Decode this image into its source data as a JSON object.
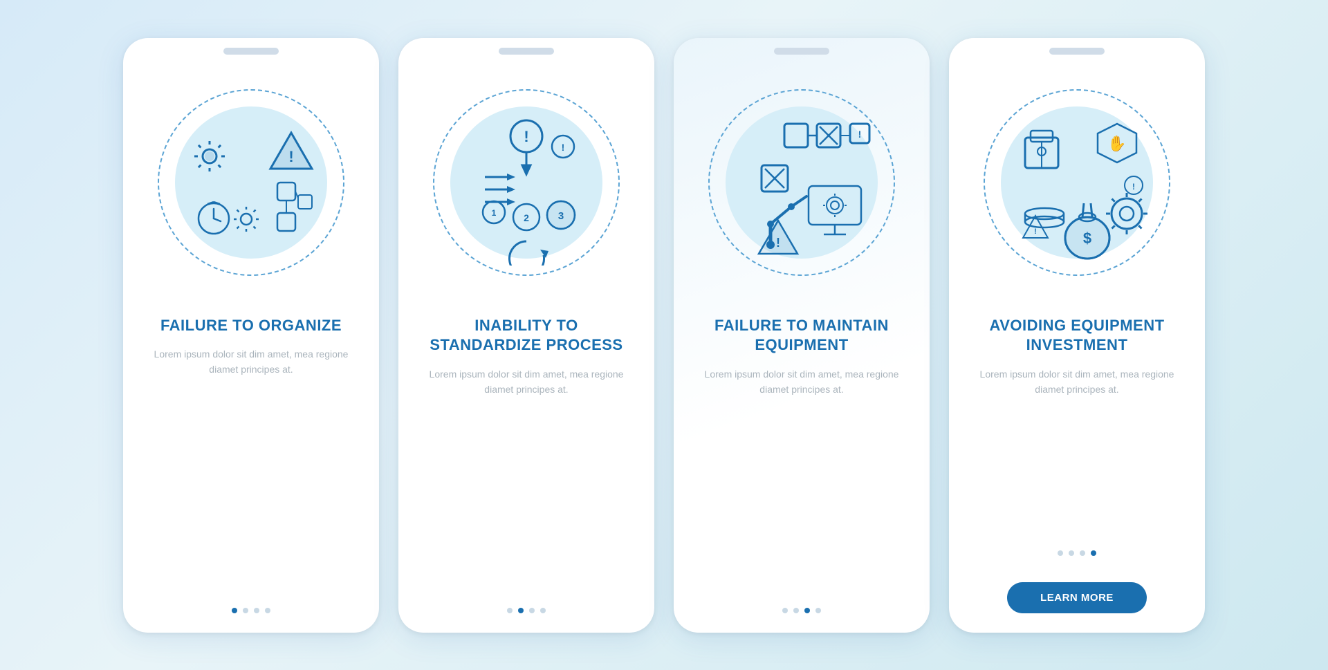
{
  "background": {
    "gradient_start": "#d6eaf8",
    "gradient_end": "#cde8f0"
  },
  "cards": [
    {
      "id": "card-1",
      "title": "FAILURE TO ORGANIZE",
      "body": "Lorem ipsum dolor sit dim amet, mea regione diamet principes at.",
      "dots": [
        true,
        false,
        false,
        false
      ],
      "has_button": false,
      "button_label": ""
    },
    {
      "id": "card-2",
      "title": "INABILITY TO STANDARDIZE PROCESS",
      "body": "Lorem ipsum dolor sit dim amet, mea regione diamet principes at.",
      "dots": [
        false,
        true,
        false,
        false
      ],
      "has_button": false,
      "button_label": ""
    },
    {
      "id": "card-3",
      "title": "FAILURE TO MAINTAIN EQUIPMENT",
      "body": "Lorem ipsum dolor sit dim amet, mea regione diamet principes at.",
      "dots": [
        false,
        false,
        true,
        false
      ],
      "has_button": false,
      "button_label": ""
    },
    {
      "id": "card-4",
      "title": "AVOIDING EQUIPMENT INVESTMENT",
      "body": "Lorem ipsum dolor sit dim amet, mea regione diamet principes at.",
      "dots": [
        false,
        false,
        false,
        true
      ],
      "has_button": true,
      "button_label": "LEARN MORE"
    }
  ]
}
